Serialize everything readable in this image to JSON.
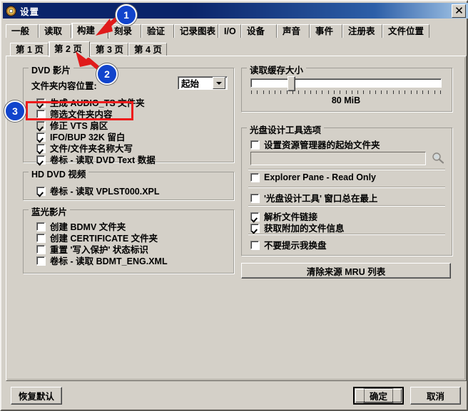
{
  "window": {
    "title": "设置",
    "icon": "disc-icon",
    "close_label": "✕"
  },
  "tabs_primary": {
    "items": [
      {
        "label": "一般"
      },
      {
        "label": "读取"
      },
      {
        "label": "构建"
      },
      {
        "label": "刻录"
      },
      {
        "label": "验证"
      },
      {
        "label": "记录图表"
      },
      {
        "label": "I/O"
      },
      {
        "label": "设备"
      },
      {
        "label": "声音"
      },
      {
        "label": "事件"
      },
      {
        "label": "注册表"
      },
      {
        "label": "文件位置"
      }
    ],
    "active_index": 2
  },
  "tabs_secondary": {
    "items": [
      {
        "label": "第 1 页"
      },
      {
        "label": "第 2 页"
      },
      {
        "label": "第 3 页"
      },
      {
        "label": "第 4 页"
      }
    ],
    "active_index": 1
  },
  "dvd_group": {
    "title": "DVD 影片",
    "folder_location_label": "文件夹内容位置:",
    "folder_location_value": "起始",
    "checkboxes": [
      {
        "label": "生成 AUDIO_TS 文件夹",
        "checked": true,
        "enabled": false
      },
      {
        "label": "筛选文件夹内容",
        "checked": false,
        "enabled": true
      },
      {
        "label": "修正 VTS 扇区",
        "checked": true,
        "enabled": false
      },
      {
        "label": "IFO/BUP 32K 留白",
        "checked": true,
        "enabled": true
      },
      {
        "label": "文件/文件夹名称大写",
        "checked": true,
        "enabled": true
      },
      {
        "label": "卷标 - 读取 DVD Text 数据",
        "checked": true,
        "enabled": true
      }
    ]
  },
  "hddvd_group": {
    "title": "HD DVD 视频",
    "checkboxes": [
      {
        "label": "卷标 - 读取 VPLST000.XPL",
        "checked": true,
        "enabled": true
      }
    ]
  },
  "bluray_group": {
    "title": "蓝光影片",
    "checkboxes": [
      {
        "label": "创建 BDMV 文件夹",
        "checked": false,
        "enabled": true
      },
      {
        "label": "创建 CERTIFICATE 文件夹",
        "checked": false,
        "enabled": true
      },
      {
        "label": "重置 '写入保护' 状态标识",
        "checked": false,
        "enabled": true
      },
      {
        "label": "卷标 - 读取 BDMT_ENG.XML",
        "checked": false,
        "enabled": true
      }
    ]
  },
  "cache_group": {
    "title": "读取缓存大小",
    "value_label": "80 MiB",
    "slider_percent": 21,
    "tick_count": 33
  },
  "disc_tool_group": {
    "title": "光盘设计工具选项",
    "checkboxes": [
      {
        "label": "设置资源管理器的起始文件夹",
        "checked": false,
        "enabled": true
      },
      {
        "label": "Explorer Pane - Read Only",
        "checked": false,
        "enabled": true
      },
      {
        "label": "'光盘设计工具' 窗口总在最上",
        "checked": false,
        "enabled": true
      },
      {
        "label": "解析文件链接",
        "checked": true,
        "enabled": true
      },
      {
        "label": "获取附加的文件信息",
        "checked": true,
        "enabled": true
      },
      {
        "label": "不要提示我换盘",
        "checked": false,
        "enabled": true
      }
    ],
    "path_input_value": "",
    "path_input_placeholder": "",
    "browse_icon": "magnifier-icon"
  },
  "mru_button": {
    "label": "清除来源 MRU 列表"
  },
  "footer": {
    "restore_defaults_label": "恢复默认",
    "ok_label": "确定",
    "cancel_label": "取消"
  },
  "annotations": {
    "badge1": "1",
    "badge2": "2",
    "badge3": "3",
    "highlight_color": "#ee1c1c",
    "badge_color": "#1144cc"
  }
}
